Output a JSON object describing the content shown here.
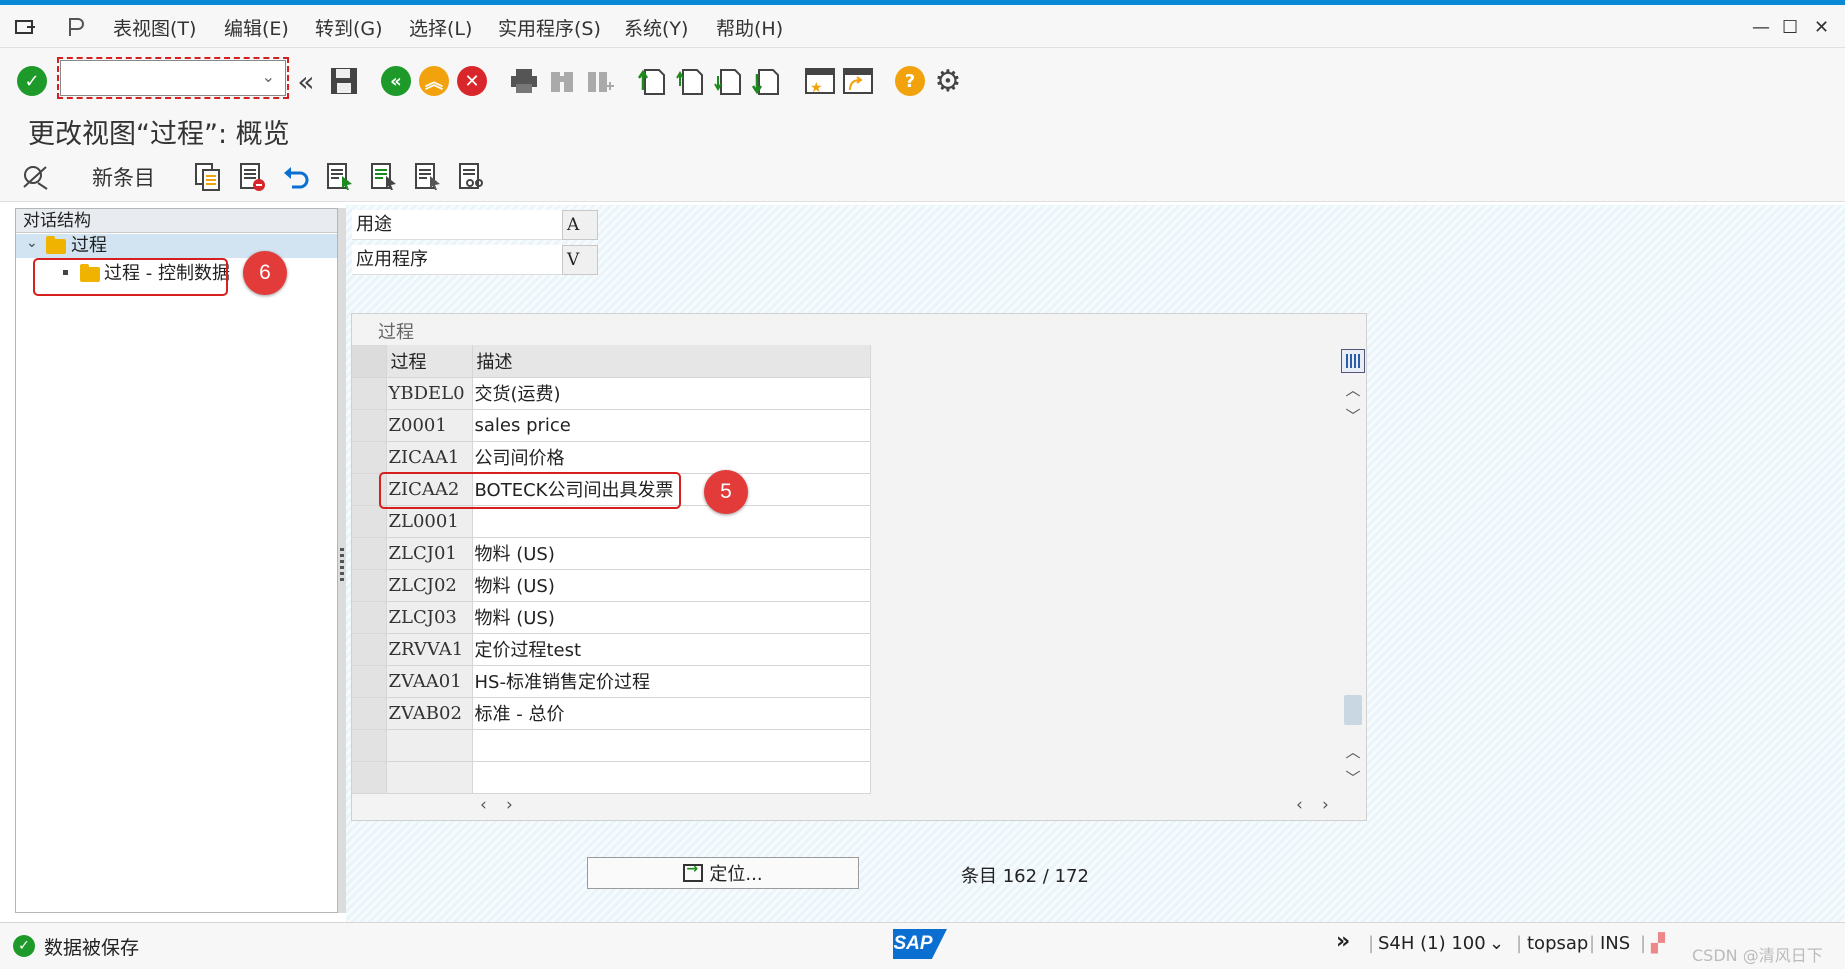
{
  "menubar": {
    "items": [
      "表视图(T)",
      "编辑(E)",
      "转到(G)",
      "选择(L)",
      "实用程序(S)",
      "系统(Y)",
      "帮助(H)"
    ]
  },
  "toolbar": {
    "command_value": "",
    "icons": [
      "enter-icon",
      "back-chevrons-icon",
      "save-icon",
      "back-icon",
      "exit-icon",
      "cancel-icon",
      "print-icon",
      "find-icon",
      "find-next-icon",
      "first-page-icon",
      "previous-page-icon",
      "next-page-icon",
      "last-page-icon",
      "create-session-icon",
      "shortcut-icon",
      "help-icon",
      "settings-icon"
    ]
  },
  "title": "更改视图“过程”: 概览",
  "app_toolbar": {
    "new_entries_label": "新条目"
  },
  "dialog_structure": {
    "header": "对话结构",
    "root_label": "过程",
    "child_label": "过程 - 控制数据",
    "badge": "6"
  },
  "header_fields": [
    {
      "label": "用途",
      "value": "A"
    },
    {
      "label": "应用程序",
      "value": "V"
    }
  ],
  "table": {
    "title": "过程",
    "columns": [
      "过程",
      "描述"
    ],
    "rows": [
      {
        "code": "YBDEL0",
        "desc": "交货(运费)"
      },
      {
        "code": "Z0001",
        "desc": "sales price"
      },
      {
        "code": "ZICAA1",
        "desc": "公司间价格"
      },
      {
        "code": "ZICAA2",
        "desc": "BOTECK公司间出具发票"
      },
      {
        "code": "ZL0001",
        "desc": ""
      },
      {
        "code": "ZLCJ01",
        "desc": "物料 (US)"
      },
      {
        "code": "ZLCJ02",
        "desc": "物料 (US)"
      },
      {
        "code": "ZLCJ03",
        "desc": "物料 (US)"
      },
      {
        "code": "ZRVVA1",
        "desc": "定价过程test"
      },
      {
        "code": "ZVAA01",
        "desc": "HS-标准销售定价过程"
      },
      {
        "code": "ZVAB02",
        "desc": "标准 - 总价"
      },
      {
        "code": "",
        "desc": ""
      },
      {
        "code": "",
        "desc": ""
      }
    ],
    "badge": "5"
  },
  "position_button_label": "定位...",
  "entries_label": "条目 162 / 172",
  "status": {
    "message": "数据被保存",
    "system": "S4H (1) 100",
    "server": "topsap",
    "mode": "INS",
    "watermark": "CSDN @清风日下"
  }
}
